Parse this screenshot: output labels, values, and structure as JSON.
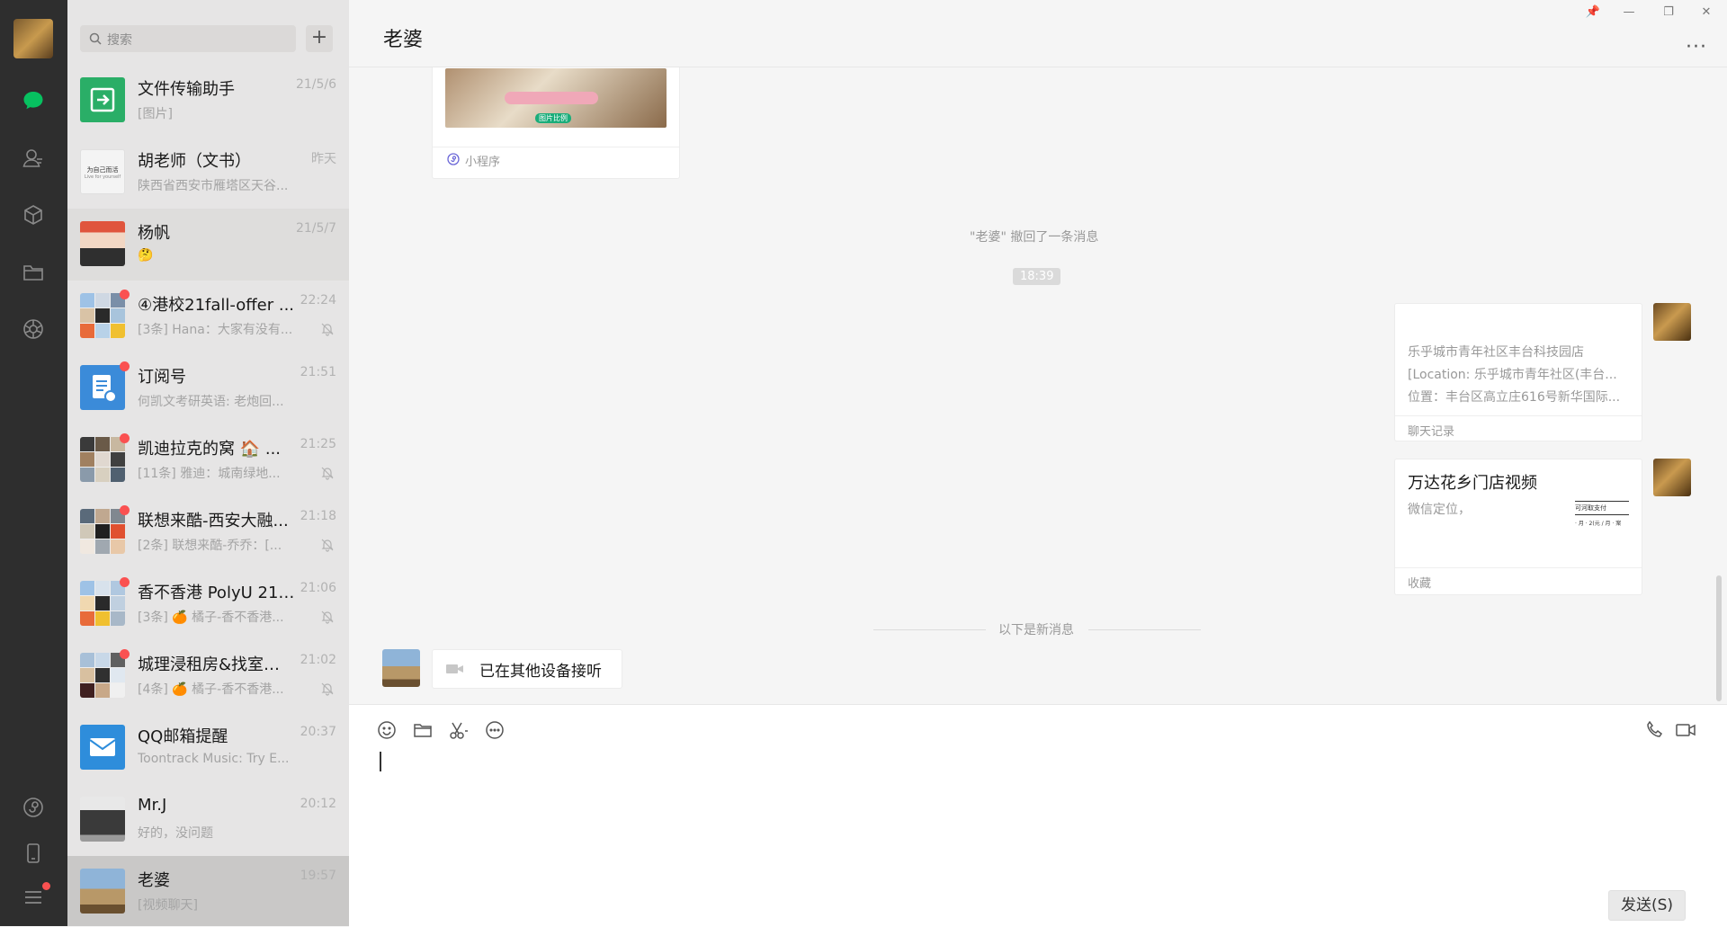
{
  "nav": {
    "icons": [
      "chat-icon",
      "contacts-icon",
      "favorites-icon",
      "files-icon",
      "moments-icon",
      "mini-program-icon",
      "phone-icon",
      "menu-icon"
    ]
  },
  "search": {
    "placeholder": "搜索",
    "add_label": "+"
  },
  "conversations": [
    {
      "name": "文件传输助手",
      "time": "21/5/6",
      "preview": "[图片]"
    },
    {
      "name": "胡老师（文书）",
      "time": "昨天",
      "preview": "陕西省西安市雁塔区天谷...",
      "avatar_text": "为自己而活",
      "avatar_sub": "Live for yourself"
    },
    {
      "name": "杨帆",
      "time": "21/5/7",
      "preview": "🤔"
    },
    {
      "name": "④港校21fall-offer ...",
      "time": "22:24",
      "preview": "[3条] Hana：大家有没有..."
    },
    {
      "name": "订阅号",
      "time": "21:51",
      "preview": "何凯文考研英语: 老炮回..."
    },
    {
      "name": "凯迪拉克的窝 🏠 ...",
      "time": "21:25",
      "preview": "[11条] 雅迪：城南绿地..."
    },
    {
      "name": "联想来酷-西安大融...",
      "time": "21:18",
      "preview": "[2条] 联想来酷-乔乔：[..."
    },
    {
      "name": "香不香港 PolyU 21F...",
      "time": "21:06",
      "preview": "[3条] 🍊 橘子-香不香港..."
    },
    {
      "name": "城理浸租房&找室友...",
      "time": "21:02",
      "preview": "[4条] 🍊 橘子-香不香港..."
    },
    {
      "name": "QQ邮箱提醒",
      "time": "20:37",
      "preview": "Toontrack Music: Try E..."
    },
    {
      "name": "Mr.J",
      "time": "20:12",
      "preview": "好的，没问题"
    },
    {
      "name": "老婆",
      "time": "19:57",
      "preview": "[视频聊天]"
    }
  ],
  "chat": {
    "title": "老婆",
    "more": "···",
    "window_controls": [
      "📌",
      "—",
      "❐",
      "✕"
    ],
    "mini_program": {
      "image_tag": "图片比例",
      "label": "小程序"
    },
    "recall_notice": "\"老婆\" 撤回了一条消息",
    "timestamp": "18:39",
    "chat_record": {
      "lines": [
        "乐乎城市青年社区丰台科技园店",
        "[Location: 乐乎城市青年社区(丰台...",
        "位置：丰台区高立庄616号新华国际..."
      ],
      "footer": "聊天记录"
    },
    "favorite": {
      "title": "万达花乡门店视频",
      "desc": "微信定位，",
      "thumb_line1": "可河取支付",
      "thumb_line2": "· 月 · 2(元 / 月 · 案",
      "footer": "收藏"
    },
    "new_divider": "以下是新消息",
    "video_call": "已在其他设备接听"
  },
  "composer": {
    "send_label": "发送(S)"
  },
  "colors": {
    "accent_green": "#07c160",
    "sidebar_bg": "#2e2e2e",
    "list_bg": "#e6e5e5",
    "badge_red": "#fa5151"
  }
}
